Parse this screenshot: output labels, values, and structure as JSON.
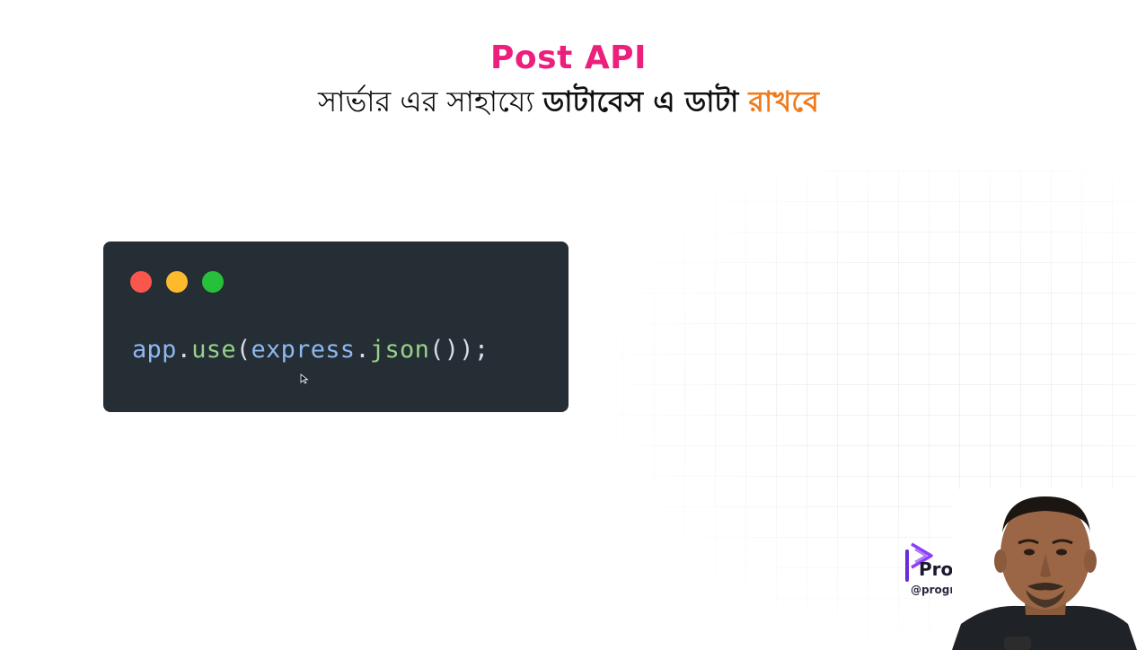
{
  "slide": {
    "title": "Post API",
    "subtitle_regular": "সার্ভার এর সাহায্যে ",
    "subtitle_bold": "ডাটাবেস এ ডাটা ",
    "subtitle_highlight": "রাখবে"
  },
  "code_window": {
    "code_obj": "app",
    "code_dot1": ".",
    "code_method": "use",
    "code_open": "(",
    "code_arg_obj": "express",
    "code_dot2": ".",
    "code_arg_fn": "json",
    "code_close": "());"
  },
  "branding": {
    "logo_text": "Programming Hero",
    "handle": "@programminghero"
  },
  "colors": {
    "title": "#ec1f7c",
    "highlight": "#f07b1d",
    "code_bg": "#252d35",
    "dot_red": "#f9564c",
    "dot_yellow": "#fdba2c",
    "dot_green": "#26c03b"
  }
}
